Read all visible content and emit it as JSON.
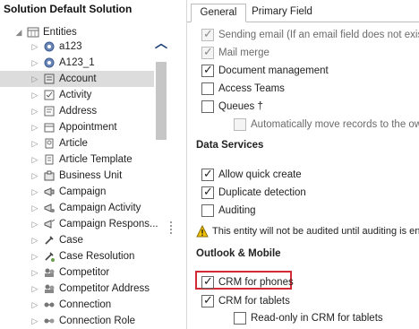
{
  "solution": {
    "title": "Solution Default Solution"
  },
  "tree": {
    "root": {
      "label": "Entities",
      "expander": "◢"
    },
    "items": [
      {
        "label": "a123",
        "expander": "▷",
        "icon": "gear-icon"
      },
      {
        "label": "A123_1",
        "expander": "▷",
        "icon": "gear-icon"
      },
      {
        "label": "Account",
        "expander": "▷",
        "icon": "account-icon",
        "selected": true
      },
      {
        "label": "Activity",
        "expander": "▷",
        "icon": "activity-icon"
      },
      {
        "label": "Address",
        "expander": "▷",
        "icon": "address-icon"
      },
      {
        "label": "Appointment",
        "expander": "▷",
        "icon": "appointment-icon"
      },
      {
        "label": "Article",
        "expander": "▷",
        "icon": "article-icon"
      },
      {
        "label": "Article Template",
        "expander": "▷",
        "icon": "article-template-icon"
      },
      {
        "label": "Business Unit",
        "expander": "▷",
        "icon": "business-unit-icon"
      },
      {
        "label": "Campaign",
        "expander": "▷",
        "icon": "campaign-icon"
      },
      {
        "label": "Campaign Activity",
        "expander": "▷",
        "icon": "campaign-activity-icon"
      },
      {
        "label": "Campaign Respons...",
        "expander": "▷",
        "icon": "campaign-response-icon"
      },
      {
        "label": "Case",
        "expander": "▷",
        "icon": "case-icon"
      },
      {
        "label": "Case Resolution",
        "expander": "▷",
        "icon": "case-resolution-icon"
      },
      {
        "label": "Competitor",
        "expander": "▷",
        "icon": "competitor-icon"
      },
      {
        "label": "Competitor Address",
        "expander": "▷",
        "icon": "competitor-address-icon"
      },
      {
        "label": "Connection",
        "expander": "▷",
        "icon": "connection-icon"
      },
      {
        "label": "Connection Role",
        "expander": "▷",
        "icon": "connection-role-icon"
      }
    ]
  },
  "scrollbar": {
    "up_arrow": "︿"
  },
  "tabs": [
    {
      "label": "General",
      "active": true
    },
    {
      "label": "Primary Field",
      "active": false
    }
  ],
  "general": {
    "top_options": [
      {
        "label": "Sending email (If an email field does not exist, one will be created)",
        "checked": true,
        "disabled": true
      },
      {
        "label": "Mail merge",
        "checked": true,
        "disabled": true
      },
      {
        "label": "Document management",
        "checked": true,
        "disabled": false
      },
      {
        "label": "Access Teams",
        "checked": false,
        "disabled": false
      },
      {
        "label": "Queues †",
        "checked": false,
        "disabled": false
      },
      {
        "label": "Automatically move records to the owner's default queue",
        "checked": false,
        "disabled": true
      }
    ],
    "data_services": {
      "heading": "Data Services",
      "options": [
        {
          "label": "Allow quick create",
          "checked": true
        },
        {
          "label": "Duplicate detection",
          "checked": true
        },
        {
          "label": "Auditing",
          "checked": false
        }
      ],
      "warning": "This entity will not be audited until auditing is enabled for the organization."
    },
    "outlook_mobile": {
      "heading": "Outlook & Mobile",
      "options": [
        {
          "label": "CRM for phones",
          "checked": true,
          "highlighted": true
        },
        {
          "label": "CRM for tablets",
          "checked": true
        },
        {
          "label": "Read-only in CRM for tablets",
          "checked": false
        }
      ]
    }
  },
  "check_glyph": "✓",
  "colors": {
    "highlight_border": "#d32a35",
    "selection": "#dcdcdc",
    "scroll_arrow": "#1c3e75",
    "warning": "#f2c200"
  }
}
